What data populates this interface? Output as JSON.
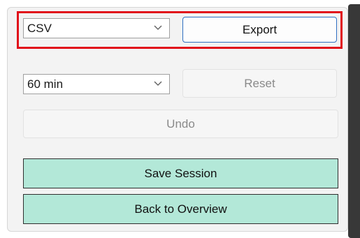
{
  "export": {
    "format_value": "CSV",
    "export_label": "Export"
  },
  "duration": {
    "value": "60 min",
    "reset_label": "Reset"
  },
  "undo_label": "Undo",
  "save_session_label": "Save Session",
  "back_label": "Back to Overview",
  "colors": {
    "highlight": "#e10f1a",
    "primary_border": "#2f6fc1",
    "action_fill": "#b3e8d8",
    "panel_background": "#f3f3f3"
  }
}
